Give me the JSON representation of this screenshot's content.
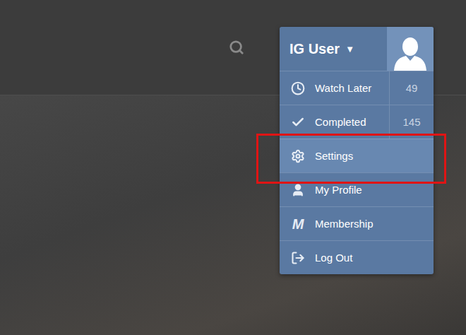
{
  "user_menu": {
    "username": "IG User",
    "caret": "▼",
    "expanded": true,
    "items": [
      {
        "label": "Watch Later",
        "kind": "clock",
        "count": "49",
        "highlighted": false,
        "annotated": false
      },
      {
        "label": "Completed",
        "kind": "check",
        "count": "145",
        "highlighted": false,
        "annotated": false
      },
      {
        "label": "Settings",
        "kind": "gear",
        "highlighted": true,
        "annotated": true
      },
      {
        "label": "My Profile",
        "kind": "user",
        "highlighted": false,
        "annotated": false
      },
      {
        "label": "Membership",
        "kind": "letter",
        "glyph": "M",
        "highlighted": false,
        "annotated": false
      },
      {
        "label": "Log Out",
        "kind": "logout",
        "highlighted": false,
        "annotated": false
      }
    ]
  }
}
